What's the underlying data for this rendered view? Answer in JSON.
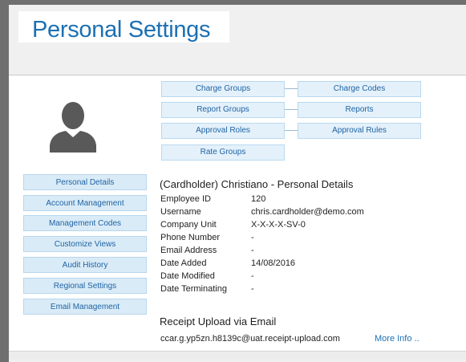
{
  "page": {
    "title": "Personal Settings"
  },
  "sidebar": {
    "items": [
      {
        "label": "Personal Details"
      },
      {
        "label": "Account Management"
      },
      {
        "label": "Management Codes"
      },
      {
        "label": "Customize Views"
      },
      {
        "label": "Audit History"
      },
      {
        "label": "Regional Settings"
      },
      {
        "label": "Email Management"
      }
    ]
  },
  "nav": {
    "charge_groups": "Charge Groups",
    "charge_codes": "Charge Codes",
    "report_groups": "Report Groups",
    "reports": "Reports",
    "approval_roles": "Approval Roles",
    "approval_rules": "Approval Rules",
    "rate_groups": "Rate Groups"
  },
  "details": {
    "heading": "(Cardholder) Christiano - Personal Details",
    "rows": [
      {
        "label": "Employee ID",
        "value": "120"
      },
      {
        "label": "Username",
        "value": "chris.cardholder@demo.com"
      },
      {
        "label": "Company Unit",
        "value": "X-X-X-X-SV-0"
      },
      {
        "label": "Phone Number",
        "value": "-"
      },
      {
        "label": "Email Address",
        "value": "-"
      },
      {
        "label": "Date Added",
        "value": "14/08/2016"
      },
      {
        "label": "Date Modified",
        "value": "-"
      },
      {
        "label": "Date Terminating",
        "value": "-"
      }
    ]
  },
  "receipt": {
    "heading": "Receipt Upload via Email",
    "email": "ccar.g.yp5zn.h8139c@uat.receipt-upload.com",
    "more_info": "More Info .."
  },
  "icons": {
    "avatar": "user-silhouette-icon"
  },
  "colors": {
    "title": "#1c70b3",
    "button_bg": "#d9ebf7",
    "button_text": "#1f63a3"
  }
}
